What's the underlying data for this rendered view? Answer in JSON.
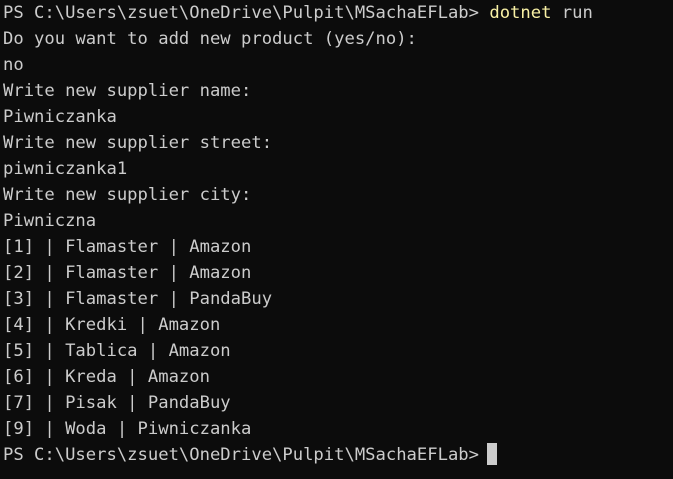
{
  "terminal": {
    "prompt_1": "PS C:\\Users\\zsuet\\OneDrive\\Pulpit\\MSachaEFLab> ",
    "command": {
      "executable": "dotnet",
      "args": " run"
    },
    "lines": [
      "Do you want to add new product (yes/no):",
      "no",
      "Write new supplier name:",
      "Piwniczanka",
      "Write new supplier street:",
      "piwniczanka1",
      "Write new supplier city:",
      "Piwniczna",
      "[1] | Flamaster | Amazon",
      "[2] | Flamaster | Amazon",
      "[3] | Flamaster | PandaBuy",
      "[4] | Kredki | Amazon",
      "[5] | Tablica | Amazon",
      "[6] | Kreda | Amazon",
      "[7] | Pisak | PandaBuy",
      "[9] | Woda | Piwniczanka"
    ],
    "prompt_2": "PS C:\\Users\\zsuet\\OneDrive\\Pulpit\\MSachaEFLab>"
  },
  "colors": {
    "background": "#0c0c0c",
    "foreground": "#cccccc",
    "command_highlight": "#f9f1a5"
  }
}
